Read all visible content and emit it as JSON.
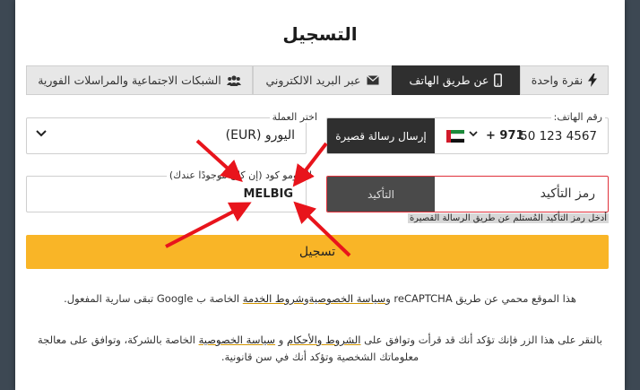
{
  "title": "التسجيل",
  "tabs": [
    {
      "id": "one-click",
      "label": "نقرة واحدة",
      "icon": "bolt-icon"
    },
    {
      "id": "phone",
      "label": "عن طريق الهاتف",
      "icon": "mobile-icon",
      "active": true
    },
    {
      "id": "email",
      "label": "عبر البريد الالكتروني",
      "icon": "envelope-icon"
    },
    {
      "id": "social",
      "label": "الشبكات الاجتماعية والمراسلات الفورية",
      "icon": "users-icon"
    }
  ],
  "phone": {
    "label": "رقم الهاتف:",
    "country_code": "+ 971",
    "number": "50 123 4567",
    "flag": "uae-flag-icon",
    "send_sms_label": "إرسال رسالة قصيرة"
  },
  "currency": {
    "label": "اختر العملة",
    "value": "اليورو (EUR)"
  },
  "confirmation": {
    "placeholder": "رمز التأكيد",
    "button_label": "التأكيد",
    "hint": "أدخل رمز التأكيد المُستلم عن طريق الرسالة القصيرة"
  },
  "promo": {
    "label": "البرومو كود (إن كان موجودًا عندك)",
    "value": "MELBIG"
  },
  "register_label": "تسجيل",
  "recaptcha": {
    "before": "هذا الموقع محمي عن طريق reCAPTCHA و",
    "privacy": "سياسة الخصوصية",
    "and": "و",
    "terms": "شروط الخدمة",
    "after": " الخاصة ب Google تبقى سارية المفعول."
  },
  "agreement": {
    "before": "بالنقر على هذا الزر فإنك تؤكد أنك قد قرأت وتوافق على ",
    "terms": "الشروط والأحكام",
    "middle": " و ",
    "privacy": "سياسة الخصوصية",
    "after": " الخاصة بالشركة، وتوافق على معالجة معلوماتك الشخصية وتؤكد أنك في سن قانونية."
  },
  "colors": {
    "accent": "#f9b527",
    "dark": "#2f2f2f",
    "error": "#e0313b",
    "arrow": "#e8141c"
  }
}
